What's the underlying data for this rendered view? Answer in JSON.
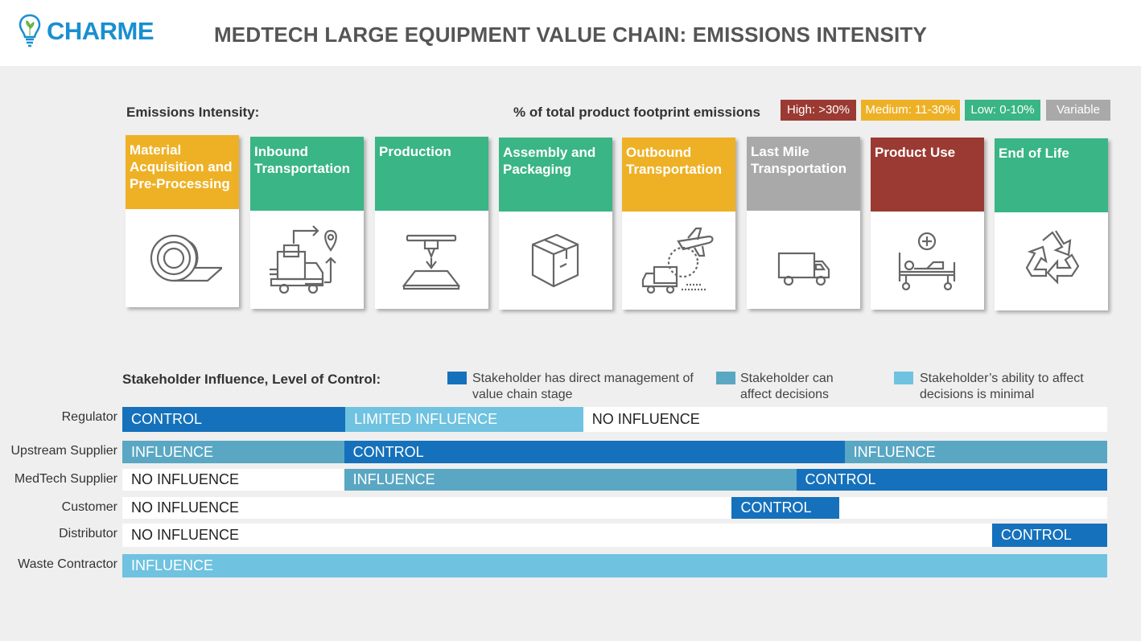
{
  "logo": {
    "text": "CHARME"
  },
  "title": "MEDTECH LARGE EQUIPMENT VALUE CHAIN: EMISSIONS INTENSITY",
  "emissions": {
    "label": "Emissions Intensity:",
    "footprint_label": "% of total product footprint emissions",
    "legend": [
      {
        "label": "High: >30%",
        "color": "#9b3a32"
      },
      {
        "label": "Medium: 11-30%",
        "color": "#eeb126"
      },
      {
        "label": "Low: 0-10%",
        "color": "#3ab585"
      },
      {
        "label": "Variable",
        "color": "#a9a9a9"
      }
    ]
  },
  "stages": [
    {
      "label": "Material Acquisition and Pre-Processing",
      "color": "#eeb126",
      "icon": "fabric-roll-icon"
    },
    {
      "label": "Inbound Transportation",
      "color": "#3ab585",
      "icon": "delivery-route-icon"
    },
    {
      "label": "Production",
      "color": "#3ab585",
      "icon": "3d-printer-icon"
    },
    {
      "label": "Assembly and Packaging",
      "color": "#3ab585",
      "icon": "box-icon"
    },
    {
      "label": "Outbound Transportation",
      "color": "#eeb126",
      "icon": "plane-truck-icon"
    },
    {
      "label": "Last Mile Transportation",
      "color": "#a9a9a9",
      "icon": "truck-icon"
    },
    {
      "label": "Product Use",
      "color": "#9b3a32",
      "icon": "hospital-bed-icon"
    },
    {
      "label": "End of Life",
      "color": "#3ab585",
      "icon": "recycle-icon"
    }
  ],
  "stakeholders": {
    "label": "Stakeholder Influence, Level of Control:",
    "legend": [
      {
        "text": "Stakeholder has direct management of value chain stage",
        "color": "#1571bb"
      },
      {
        "text": "Stakeholder can affect decisions",
        "color": "#5aa7c3"
      },
      {
        "text": "Stakeholder’s ability to affect decisions is minimal",
        "color": "#6fc2e0"
      }
    ],
    "rows": [
      {
        "name": "Regulator",
        "segments": [
          {
            "label": "CONTROL",
            "kind": "ctl",
            "start": 0,
            "end": 1.8
          },
          {
            "label": "LIMITED INFLUENCE",
            "kind": "lim",
            "start": 1.8,
            "end": 3.72
          },
          {
            "label": "NO INFLUENCE",
            "kind": "non",
            "start": 3.72,
            "end": 7.95
          }
        ]
      },
      {
        "name": "Upstream Supplier",
        "segments": [
          {
            "label": "INFLUENCE",
            "kind": "inf",
            "start": 0,
            "end": 1.79
          },
          {
            "label": "CONTROL",
            "kind": "ctl",
            "start": 1.79,
            "end": 5.83
          },
          {
            "label": "INFLUENCE",
            "kind": "inf",
            "start": 5.83,
            "end": 7.95
          }
        ]
      },
      {
        "name": "MedTech Supplier",
        "segments": [
          {
            "label": "NO INFLUENCE",
            "kind": "non",
            "start": 0,
            "end": 1.79
          },
          {
            "label": "INFLUENCE",
            "kind": "inf",
            "start": 1.79,
            "end": 5.44
          },
          {
            "label": "CONTROL",
            "kind": "ctl",
            "start": 5.44,
            "end": 7.95
          }
        ]
      },
      {
        "name": "Customer",
        "segments": [
          {
            "label": "NO INFLUENCE",
            "kind": "non",
            "start": 0,
            "end": 4.92
          },
          {
            "label": "CONTROL",
            "kind": "ctl",
            "start": 4.92,
            "end": 5.79
          },
          {
            "label": "",
            "kind": "non",
            "start": 5.79,
            "end": 7.95
          }
        ]
      },
      {
        "name": "Distributor",
        "segments": [
          {
            "label": "NO INFLUENCE",
            "kind": "non",
            "start": 0,
            "end": 7.02
          },
          {
            "label": "CONTROL",
            "kind": "ctl",
            "start": 7.02,
            "end": 7.95
          }
        ]
      },
      {
        "name": "Waste Contractor",
        "segments": [
          {
            "label": "INFLUENCE",
            "kind": "lim",
            "start": 0,
            "end": 7.95
          }
        ]
      }
    ]
  }
}
